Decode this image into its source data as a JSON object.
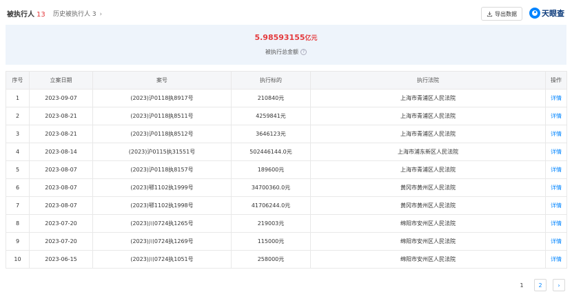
{
  "header": {
    "main_tab": {
      "label": "被执行人",
      "count": "13"
    },
    "history_tab": {
      "label": "历史被执行人",
      "count": "3"
    },
    "export_label": "导出数据",
    "logo_text": "天眼查"
  },
  "summary": {
    "amount": "5.98593155",
    "unit": "亿元",
    "label": "被执行总金额"
  },
  "table": {
    "columns": [
      "序号",
      "立案日期",
      "案号",
      "执行标的",
      "执行法院",
      "操作"
    ],
    "rows": [
      {
        "no": "1",
        "date": "2023-09-07",
        "case": "(2023)沪0118执8917号",
        "amount": "210840元",
        "court": "上海市青浦区人民法院",
        "action": "详情"
      },
      {
        "no": "2",
        "date": "2023-08-21",
        "case": "(2023)沪0118执8511号",
        "amount": "4259841元",
        "court": "上海市青浦区人民法院",
        "action": "详情"
      },
      {
        "no": "3",
        "date": "2023-08-21",
        "case": "(2023)沪0118执8512号",
        "amount": "3646123元",
        "court": "上海市青浦区人民法院",
        "action": "详情"
      },
      {
        "no": "4",
        "date": "2023-08-14",
        "case": "(2023)沪0115执31551号",
        "amount": "502446144.0元",
        "court": "上海市浦东新区人民法院",
        "action": "详情"
      },
      {
        "no": "5",
        "date": "2023-08-07",
        "case": "(2023)沪0118执8157号",
        "amount": "189600元",
        "court": "上海市青浦区人民法院",
        "action": "详情"
      },
      {
        "no": "6",
        "date": "2023-08-07",
        "case": "(2023)鄂1102执1999号",
        "amount": "34700360.0元",
        "court": "黄冈市黄州区人民法院",
        "action": "详情"
      },
      {
        "no": "7",
        "date": "2023-08-07",
        "case": "(2023)鄂1102执1998号",
        "amount": "41706244.0元",
        "court": "黄冈市黄州区人民法院",
        "action": "详情"
      },
      {
        "no": "8",
        "date": "2023-07-20",
        "case": "(2023)川0724执1265号",
        "amount": "219003元",
        "court": "绵阳市安州区人民法院",
        "action": "详情"
      },
      {
        "no": "9",
        "date": "2023-07-20",
        "case": "(2023)川0724执1269号",
        "amount": "115000元",
        "court": "绵阳市安州区人民法院",
        "action": "详情"
      },
      {
        "no": "10",
        "date": "2023-06-15",
        "case": "(2023)川0724执1051号",
        "amount": "258000元",
        "court": "绵阳市安州区人民法院",
        "action": "详情"
      }
    ]
  },
  "pagination": {
    "pages": [
      "1",
      "2"
    ],
    "current": "1",
    "next_icon": "chevron-right-icon"
  },
  "colors": {
    "accent": "#0084ff",
    "amount_red": "#e4393c",
    "summary_bg": "#eef4fb"
  }
}
